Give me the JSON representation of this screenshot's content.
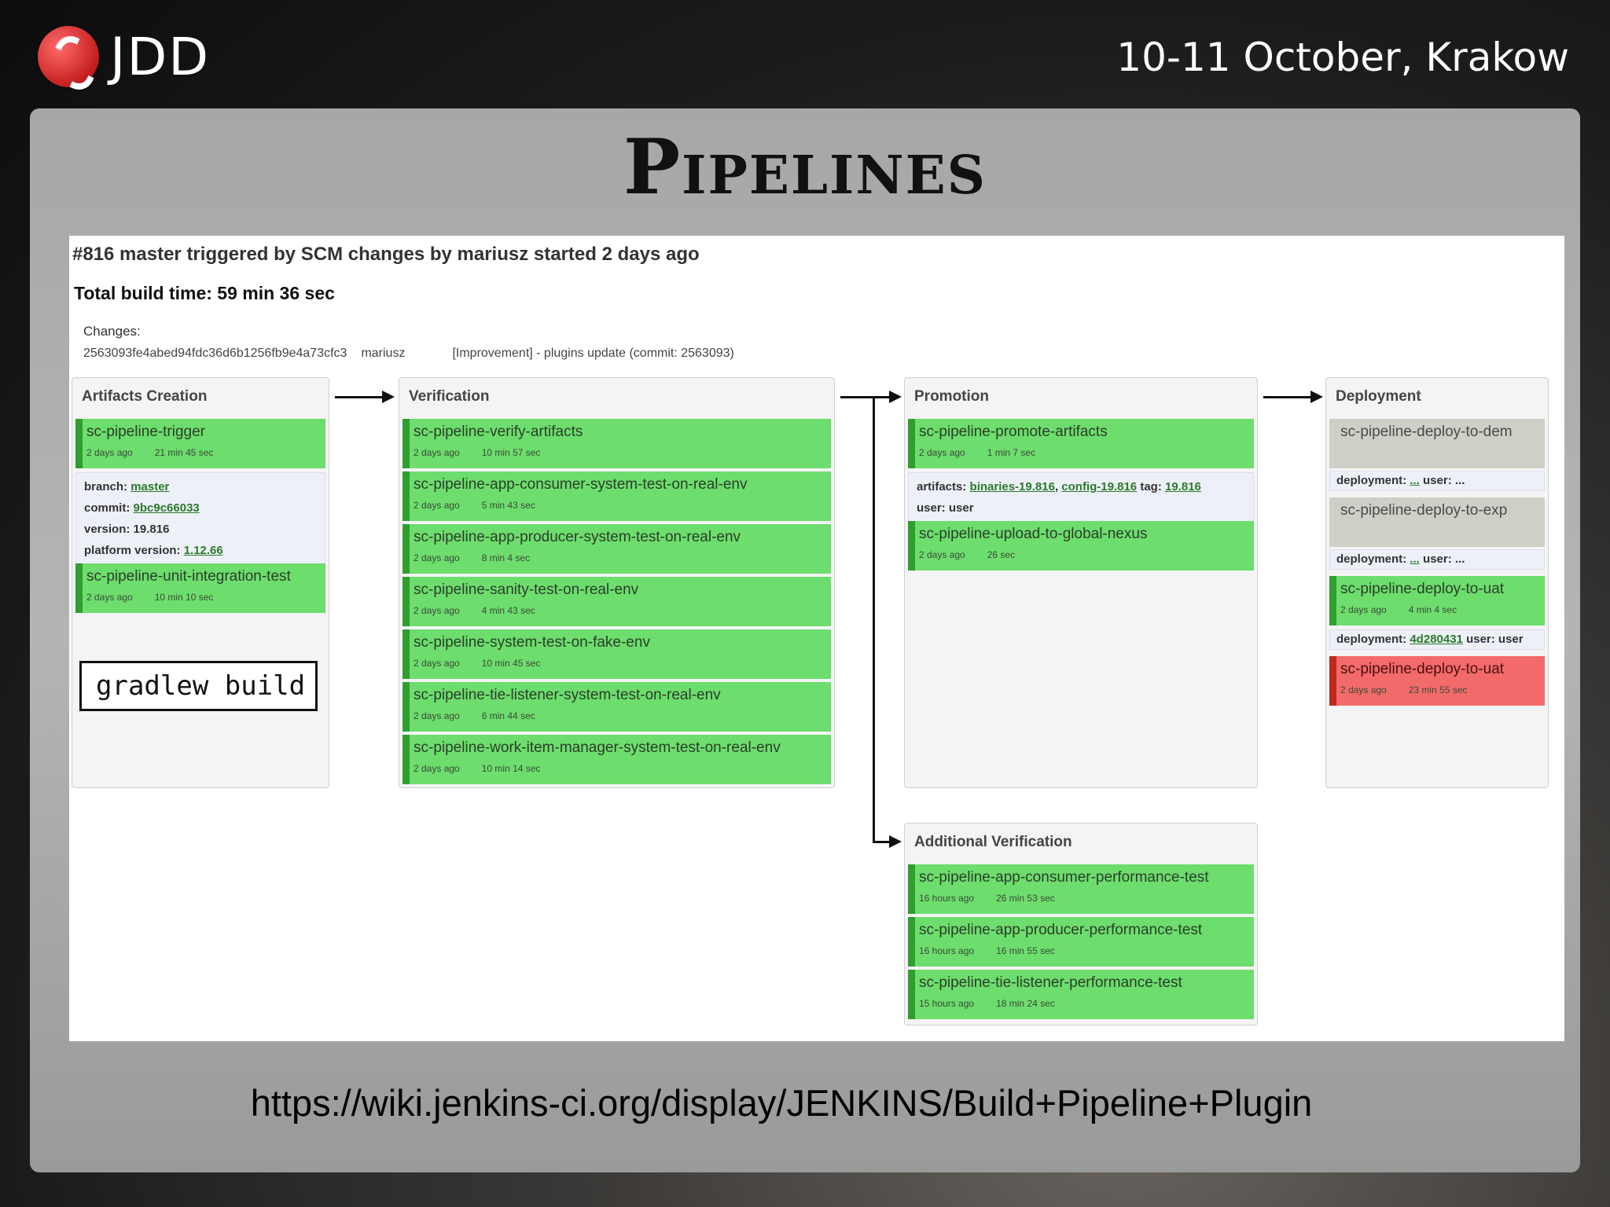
{
  "header": {
    "logo_text": "JDD",
    "event": "10-11 October, Krakow"
  },
  "slide": {
    "title": "Pipelines",
    "url": "https://wiki.jenkins-ci.org/display/JENKINS/Build+Pipeline+Plugin"
  },
  "build": {
    "title": "#816 master triggered by SCM changes by mariusz started 2 days ago",
    "time_label": "Total build time: ",
    "time_value": "59 min 36 sec",
    "changes_label": "Changes:",
    "change_hash": "2563093fe4abed94fdc36d6b1256fb9e4a73cfc3",
    "change_author": "mariusz",
    "change_msg": "[Improvement] - plugins update (commit: 2563093)"
  },
  "stages": {
    "artifacts": {
      "title": "Artifacts Creation",
      "jobs": [
        {
          "name": "sc-pipeline-trigger",
          "ago": "2 days ago",
          "duration": "21 min 45 sec"
        },
        {
          "name": "sc-pipeline-unit-integration-test",
          "ago": "2 days ago",
          "duration": "10 min 10 sec"
        }
      ],
      "info": {
        "branch_label": "branch: ",
        "branch": "master",
        "commit_label": "commit: ",
        "commit": "9bc9c66033",
        "version_label": "version: ",
        "version": "19.816",
        "platform_label": "platform version: ",
        "platform": "1.12.66"
      }
    },
    "verification": {
      "title": "Verification",
      "jobs": [
        {
          "name": "sc-pipeline-verify-artifacts",
          "ago": "2 days ago",
          "duration": "10 min 57 sec"
        },
        {
          "name": "sc-pipeline-app-consumer-system-test-on-real-env",
          "ago": "2 days ago",
          "duration": "5 min 43 sec"
        },
        {
          "name": "sc-pipeline-app-producer-system-test-on-real-env",
          "ago": "2 days ago",
          "duration": "8 min 4 sec"
        },
        {
          "name": "sc-pipeline-sanity-test-on-real-env",
          "ago": "2 days ago",
          "duration": "4 min 43 sec"
        },
        {
          "name": "sc-pipeline-system-test-on-fake-env",
          "ago": "2 days ago",
          "duration": "10 min 45 sec"
        },
        {
          "name": "sc-pipeline-tie-listener-system-test-on-real-env",
          "ago": "2 days ago",
          "duration": "6 min 44 sec"
        },
        {
          "name": "sc-pipeline-work-item-manager-system-test-on-real-env",
          "ago": "2 days ago",
          "duration": "10 min 14 sec"
        }
      ]
    },
    "promotion": {
      "title": "Promotion",
      "jobs": [
        {
          "name": "sc-pipeline-promote-artifacts",
          "ago": "2 days ago",
          "duration": "1 min 7 sec"
        },
        {
          "name": "sc-pipeline-upload-to-global-nexus",
          "ago": "2 days ago",
          "duration": "26 sec"
        }
      ],
      "info": {
        "artifacts_label": "artifacts: ",
        "artifact1": "binaries-19.816",
        "sep": ", ",
        "artifact2": "config-19.816",
        "tag_label": " tag: ",
        "tag": "19.816",
        "user_line": "user: user"
      }
    },
    "deployment": {
      "title": "Deployment",
      "jobs": [
        {
          "name": "sc-pipeline-deploy-to-dem",
          "ago": "",
          "duration": ""
        },
        {
          "name": "sc-pipeline-deploy-to-exp",
          "ago": "",
          "duration": ""
        },
        {
          "name": "sc-pipeline-deploy-to-uat",
          "ago": "2 days ago",
          "duration": "4 min 4 sec"
        },
        {
          "name": "sc-pipeline-deploy-to-uat",
          "ago": "2 days ago",
          "duration": "23 min 55 sec"
        }
      ],
      "info": {
        "deployment_label": "deployment: ",
        "user_label": " user: ",
        "dem_dep": "...",
        "dem_user": "...",
        "exp_dep": "...",
        "exp_user": "...",
        "uat_dep": "4d280431",
        "uat_user": "user"
      }
    },
    "additional": {
      "title": "Additional Verification",
      "jobs": [
        {
          "name": "sc-pipeline-app-consumer-performance-test",
          "ago": "16 hours ago",
          "duration": "26 min 53 sec"
        },
        {
          "name": "sc-pipeline-app-producer-performance-test",
          "ago": "16 hours ago",
          "duration": "16 min 55 sec"
        },
        {
          "name": "sc-pipeline-tie-listener-performance-test",
          "ago": "15 hours ago",
          "duration": "18 min 24 sec"
        }
      ]
    }
  },
  "callout": "gradlew build",
  "colors": {
    "success": "#6ddd6d",
    "success_border": "#2f9e2f",
    "pending": "#cfcfc7",
    "failed": "#f36a6a",
    "failed_border": "#c0281e"
  }
}
